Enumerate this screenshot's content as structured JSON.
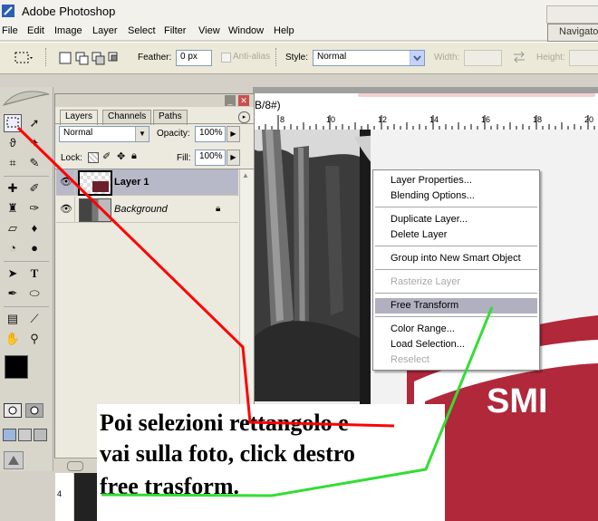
{
  "window": {
    "title": "Adobe Photoshop"
  },
  "menubar": {
    "items": [
      "File",
      "Edit",
      "Image",
      "Layer",
      "Select",
      "Filter",
      "View",
      "Window",
      "Help"
    ],
    "navigator_tab": "Navigator"
  },
  "options": {
    "feather_label": "Feather:",
    "feather_value": "0 px",
    "antialias_label": "Anti-alias",
    "style_label": "Style:",
    "style_value": "Normal",
    "width_label": "Width:",
    "height_label": "Height:"
  },
  "document": {
    "title_fragment": "B/8#)",
    "ruler_ticks": [
      "8",
      "10",
      "12",
      "14",
      "16",
      "18",
      "20"
    ],
    "left_ruler_tick": "4"
  },
  "layers_panel": {
    "tabs": [
      "Layers",
      "Channels",
      "Paths"
    ],
    "blend_mode": "Normal",
    "opacity_label": "Opacity:",
    "opacity_value": "100%",
    "lock_label": "Lock:",
    "fill_label": "Fill:",
    "fill_value": "100%",
    "layers": [
      {
        "name": "Layer 1",
        "selected": true
      },
      {
        "name": "Background",
        "selected": false,
        "locked": true
      }
    ]
  },
  "context_menu": {
    "items": [
      {
        "label": "Layer Properties...",
        "enabled": true
      },
      {
        "label": "Blending Options...",
        "enabled": true
      },
      {
        "label": "Duplicate Layer...",
        "enabled": true
      },
      {
        "label": "Delete Layer",
        "enabled": true
      },
      {
        "label": "Group into New Smart Object",
        "enabled": true
      },
      {
        "label": "Rasterize Layer",
        "enabled": false
      },
      {
        "label": "Free Transform",
        "enabled": true,
        "highlighted": true
      },
      {
        "label": "Color Range...",
        "enabled": true
      },
      {
        "label": "Load Selection...",
        "enabled": true
      },
      {
        "label": "Reselect",
        "enabled": false
      }
    ]
  },
  "caption": {
    "line1": "Poi selezioni rettangolo e",
    "line2": "vai sulla foto, click destro",
    "line3": "free trasform."
  },
  "photo_sign_text": "SMI",
  "colors": {
    "red_annotation": "#ff0000",
    "green_annotation": "#33dd33",
    "highlight": "#b0b0c0",
    "sign_red": "#b0283a"
  }
}
